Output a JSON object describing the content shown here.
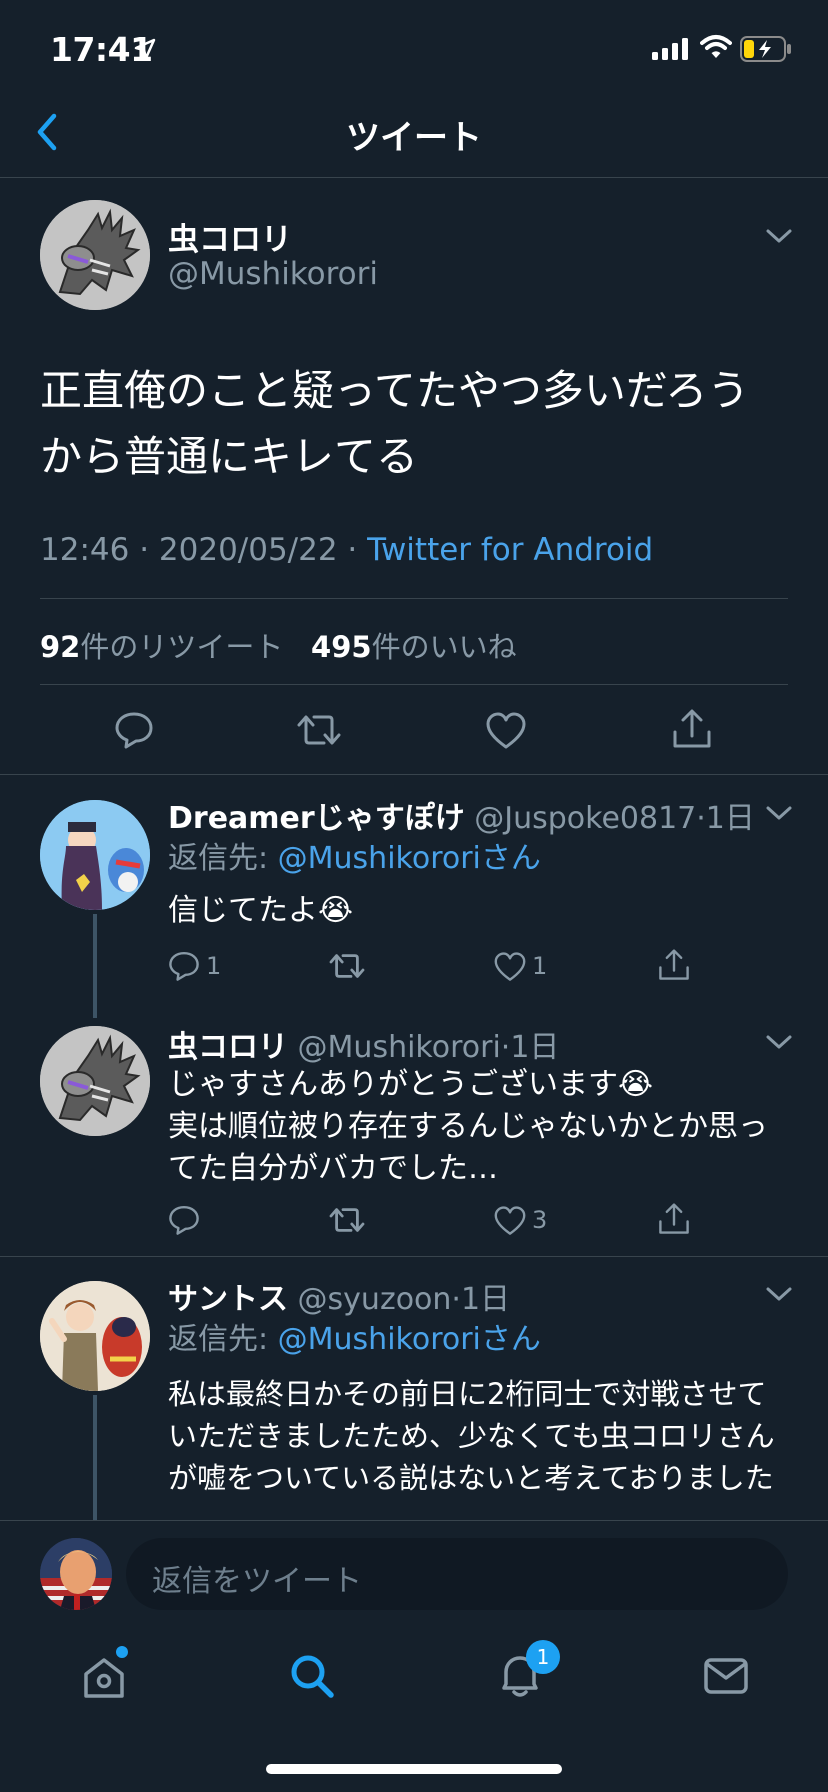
{
  "status": {
    "time": "17:41"
  },
  "nav": {
    "title": "ツイート"
  },
  "tweet": {
    "name": "虫コロリ",
    "handle": "@Mushikorori",
    "text": "正直俺のこと疑ってたやつ多いだろうから普通にキレてる",
    "time": "12:46 · 2020/05/22 · ",
    "source": "Twitter for Android",
    "retweets": "92",
    "retweets_label": "件のリツイート",
    "likes": "495",
    "likes_label": "件のいいね"
  },
  "replies": [
    {
      "name": "Dreamerじゃすぽけ",
      "handle": "@Juspoke0817",
      "time": "·1日",
      "reply_prefix": "返信先: ",
      "reply_to": "@Mushikororiさん",
      "text": "信じてたよ😭",
      "reply_count": "1",
      "like_count": "1"
    },
    {
      "name": "虫コロリ",
      "handle": "@Mushikorori",
      "time": "·1日",
      "text_line1": "じゃすさんありがとうございます😭",
      "text_line2": "実は順位被り存在するんじゃないかとか思ってた自分がバカでした…",
      "like_count": "3"
    },
    {
      "name": "サントス",
      "handle": "@syuzoon",
      "time": "·1日",
      "reply_prefix": "返信先: ",
      "reply_to": "@Mushikororiさん",
      "text": "私は最終日かその前日に2桁同士で対戦させていただきましたため、少なくても虫コロリさんが嘘をついている説はないと考えておりました"
    }
  ],
  "composer": {
    "placeholder": "返信をツイート"
  },
  "tabs": {
    "notifications_badge": "1"
  },
  "colors": {
    "background": "#15202b",
    "accent": "#1da1f2",
    "muted": "#8899a6",
    "divider": "#38444d"
  }
}
